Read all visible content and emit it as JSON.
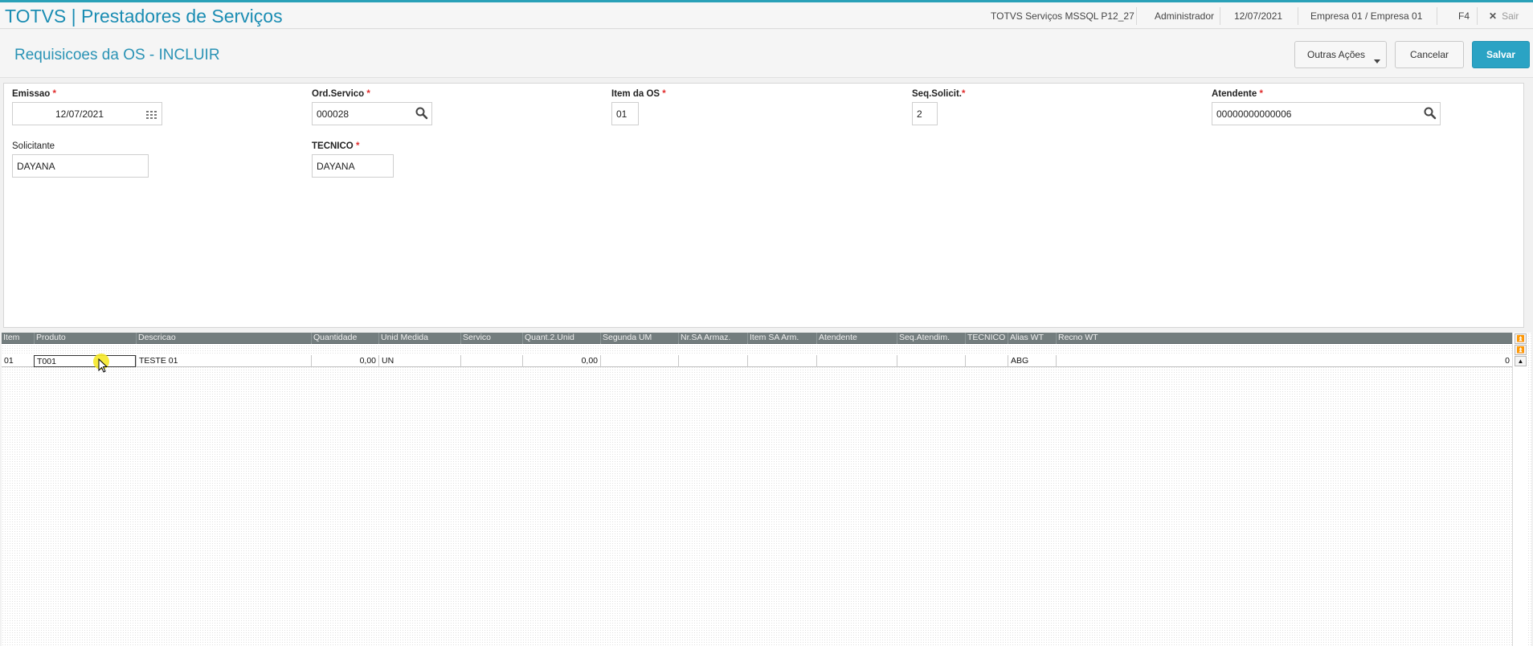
{
  "topbar": {
    "app_title": "TOTVS | Prestadores de Serviços",
    "environment": "TOTVS Serviços MSSQL P12_27",
    "user": "Administrador",
    "date": "12/07/2021",
    "company": "Empresa 01 / Empresa 01",
    "shortcut": "F4",
    "exit_label": "Sair"
  },
  "page": {
    "title": "Requisicoes da OS - INCLUIR",
    "more_actions_label": "Outras Ações",
    "cancel_label": "Cancelar",
    "save_label": "Salvar"
  },
  "form": {
    "emissao": {
      "label": "Emissao",
      "required": "*",
      "value": "12/07/2021"
    },
    "ord_servico": {
      "label": "Ord.Servico",
      "required": "*",
      "value": "000028"
    },
    "item_os": {
      "label": "Item da OS",
      "required": "*",
      "value": "01"
    },
    "seq_solicit": {
      "label": "Seq.Solicit.",
      "required": "*",
      "value": "2"
    },
    "atendente": {
      "label": "Atendente",
      "required": "*",
      "value": "00000000000006"
    },
    "solicitante": {
      "label": "Solicitante",
      "value": "DAYANA"
    },
    "tecnico": {
      "label": "TECNICO",
      "required": "*",
      "value": "DAYANA"
    }
  },
  "grid": {
    "columns": [
      "Item",
      "Produto",
      "Descricao",
      "Quantidade",
      "Unid Medida",
      "Servico",
      "Quant.2.Unid",
      "Segunda UM",
      "Nr.SA Armaz.",
      "Item SA Arm.",
      "Atendente",
      "Seq.Atendim.",
      "TECNICO",
      "Alias WT",
      "Recno WT"
    ],
    "row": {
      "item": "01",
      "produto": "T001",
      "descricao": "TESTE 01",
      "quantidade": "0,00",
      "unid_medida": "UN",
      "servico": "",
      "quant_2_unid": "0,00",
      "segunda_um": "",
      "nr_sa_armaz": "",
      "item_sa_arm": "",
      "atendente": "",
      "seq_atendim": "",
      "tecnico": "",
      "alias_wt": "ABG",
      "recno_wt": "0"
    }
  },
  "colors": {
    "accent": "#2aa3c4",
    "title_blue": "#1b8db3",
    "grid_header": "#737d7e",
    "required": "#e02b2b"
  },
  "icons": {
    "calendar": "calendar-icon",
    "search": "search-icon",
    "close": "close-icon",
    "dropdown": "chevron-down-icon",
    "pointer": "mouse-pointer-icon"
  }
}
